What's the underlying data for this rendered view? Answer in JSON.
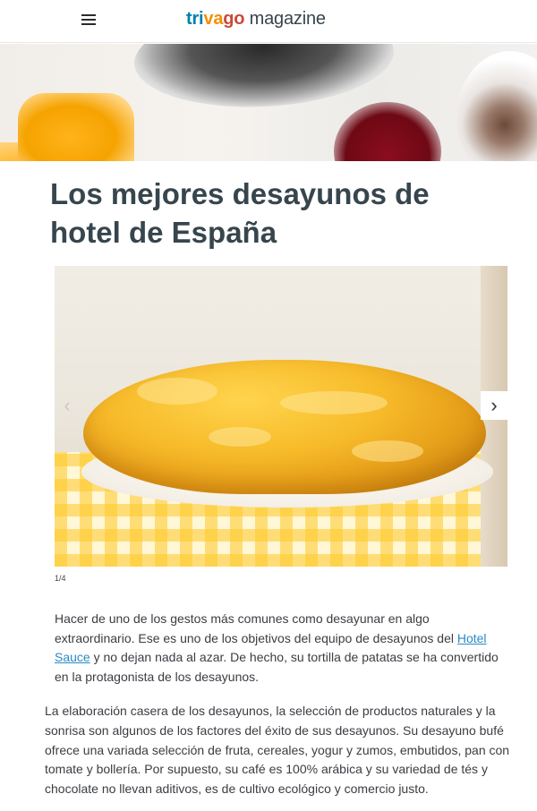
{
  "header": {
    "logo": {
      "part1": "tri",
      "part2": "va",
      "part3": "go",
      "magazine": "magazine"
    },
    "menu_icon": "hamburger-icon"
  },
  "hero": {
    "alt": ""
  },
  "article": {
    "title": "Los mejores desayunos de hotel de España",
    "gallery": {
      "counter": "1/4",
      "prev_icon": "chevron-left-icon",
      "next_icon": "chevron-right-icon",
      "prev_glyph": "‹",
      "next_glyph": "›"
    },
    "intro": {
      "before_link": "Hacer de uno de los gestos más comunes como desayunar en algo extraordinario. Ese es uno de los objetivos del equipo de desayunos del ",
      "link_text": "Hotel Sauce",
      "after_link": " y no dejan nada al azar. De hecho, su tortilla de patatas se ha convertido en la protagonista de los desayunos."
    },
    "body": "La elaboración casera de los desayunos, la selección de productos naturales y la sonrisa son algunos de los factores del éxito de sus desayunos. Su desayuno bufé ofrece una variada selección de fruta, cereales, yogur y zumos, embutidos, pan con tomate y bollería. Por supuesto, su café es 100% arábica y su variedad de tés y chocolate no llevan aditivos, es de cultivo ecológico y comercio justo."
  },
  "colors": {
    "title": "#37454d",
    "link": "#2a8ac6",
    "logo_blue": "#007fad",
    "logo_orange": "#f48f00",
    "logo_red": "#c94a38"
  }
}
